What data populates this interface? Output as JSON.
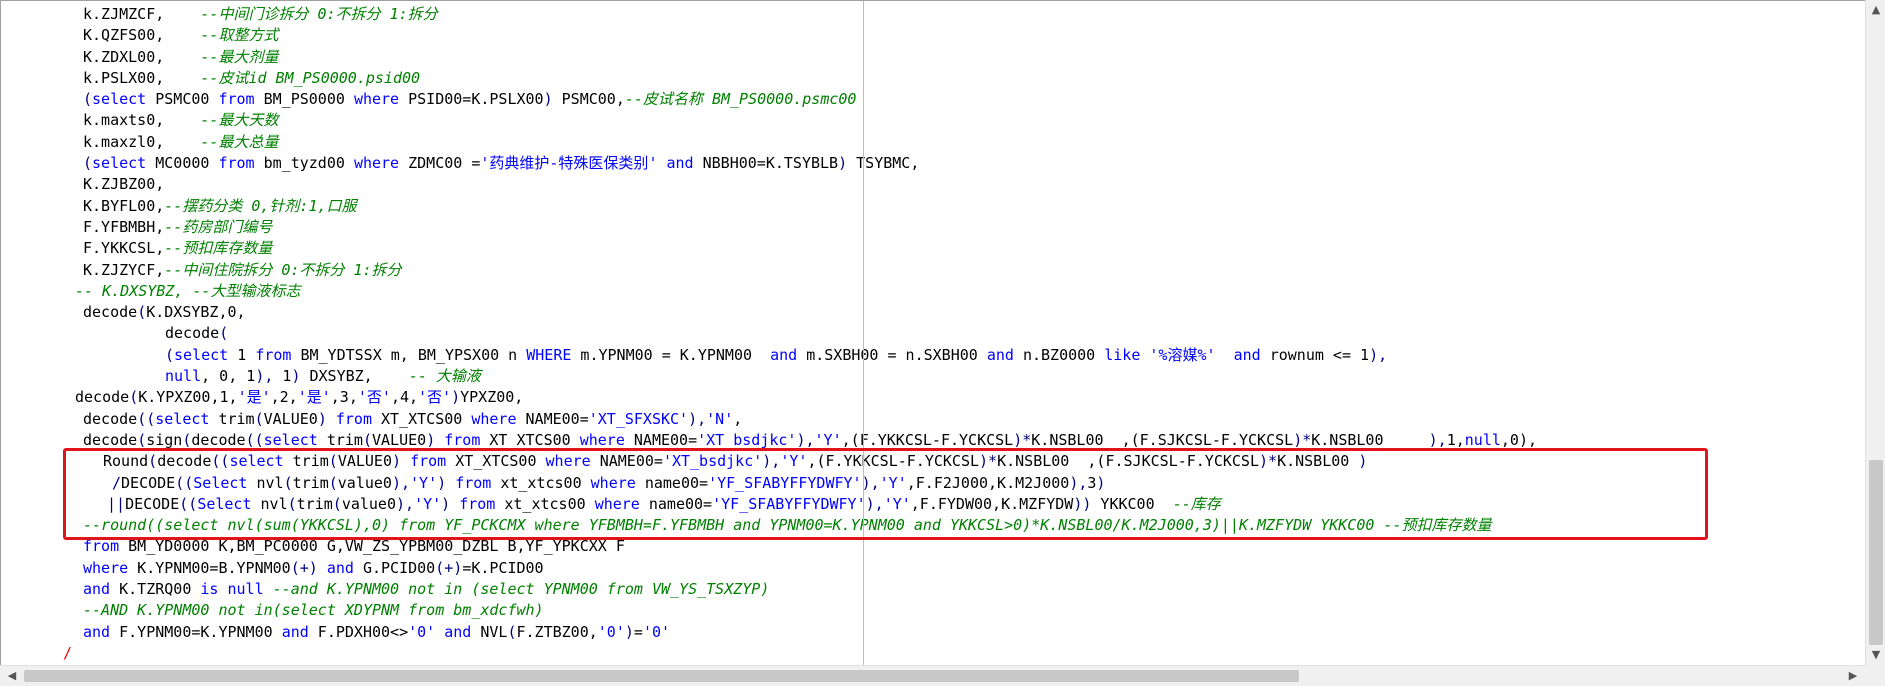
{
  "editor": {
    "lines": [
      {
        "indent": 82,
        "tokens": [
          {
            "t": "k.ZJMZCF,    "
          },
          {
            "t": "--中间门诊拆分 0:不拆分 1:拆分",
            "c": "cm"
          }
        ]
      },
      {
        "indent": 82,
        "tokens": [
          {
            "t": "K.QZFS00,    "
          },
          {
            "t": "--取整方式",
            "c": "cm"
          }
        ]
      },
      {
        "indent": 82,
        "tokens": [
          {
            "t": "K.ZDXL00,    "
          },
          {
            "t": "--最大剂量",
            "c": "cm"
          }
        ]
      },
      {
        "indent": 82,
        "tokens": [
          {
            "t": "k.PSLX00,    "
          },
          {
            "t": "--皮试id BM_PS0000.psid00",
            "c": "cm"
          }
        ]
      },
      {
        "indent": 82,
        "tokens": [
          {
            "t": "(",
            "c": "op"
          },
          {
            "t": "select",
            "c": "kw"
          },
          {
            "t": " PSMC00 "
          },
          {
            "t": "from",
            "c": "kw"
          },
          {
            "t": " BM_PS0000 "
          },
          {
            "t": "where",
            "c": "kw"
          },
          {
            "t": " PSID00="
          },
          {
            "t": "K.PSLX00"
          },
          {
            "t": ")",
            "c": "op"
          },
          {
            "t": " PSMC00,"
          },
          {
            "t": "--皮试名称 BM_PS0000.psmc00",
            "c": "cm"
          }
        ]
      },
      {
        "indent": 82,
        "tokens": [
          {
            "t": "k.maxts0,    "
          },
          {
            "t": "--最大天数",
            "c": "cm"
          }
        ]
      },
      {
        "indent": 82,
        "tokens": [
          {
            "t": "k.maxzl0,    "
          },
          {
            "t": "--最大总量",
            "c": "cm"
          }
        ]
      },
      {
        "indent": 82,
        "tokens": [
          {
            "t": "(",
            "c": "op"
          },
          {
            "t": "select",
            "c": "kw"
          },
          {
            "t": " MC0000 "
          },
          {
            "t": "from",
            "c": "kw"
          },
          {
            "t": " bm_tyzd00 "
          },
          {
            "t": "where",
            "c": "kw"
          },
          {
            "t": " ZDMC00 ="
          },
          {
            "t": "'药典维护-特殊医保类别'",
            "c": "st"
          },
          {
            "t": " "
          },
          {
            "t": "and",
            "c": "kw"
          },
          {
            "t": " NBBH00=K.TSYBLB"
          },
          {
            "t": ")",
            "c": "op"
          },
          {
            "t": " TSYBMC,"
          }
        ]
      },
      {
        "indent": 82,
        "tokens": [
          {
            "t": "K.ZJBZ00,"
          }
        ]
      },
      {
        "indent": 82,
        "tokens": [
          {
            "t": "K.BYFL00,"
          },
          {
            "t": "--摆药分类 0,针剂:1,口服",
            "c": "cm"
          }
        ]
      },
      {
        "indent": 82,
        "tokens": [
          {
            "t": "F.YFBMBH,"
          },
          {
            "t": "--药房部门编号",
            "c": "cm"
          }
        ]
      },
      {
        "indent": 82,
        "tokens": [
          {
            "t": "F.YKKCSL,"
          },
          {
            "t": "--预扣库存数量",
            "c": "cm"
          }
        ]
      },
      {
        "indent": 82,
        "tokens": [
          {
            "t": "K.ZJZYCF,"
          },
          {
            "t": "--中间住院拆分 0:不拆分 1:拆分",
            "c": "cm"
          }
        ]
      },
      {
        "indent": 74,
        "tokens": [
          {
            "t": "-- K.DXSYBZ, --大型输液标志",
            "c": "cm"
          }
        ]
      },
      {
        "indent": 82,
        "tokens": [
          {
            "t": "decode"
          },
          {
            "t": "(",
            "c": "op"
          },
          {
            "t": "K.DXSYBZ,0,"
          }
        ]
      },
      {
        "indent": 164,
        "tokens": [
          {
            "t": "decode"
          },
          {
            "t": "(",
            "c": "op"
          }
        ]
      },
      {
        "indent": 164,
        "tokens": [
          {
            "t": "(",
            "c": "op"
          },
          {
            "t": "select",
            "c": "kw"
          },
          {
            "t": " 1 "
          },
          {
            "t": "from",
            "c": "kw"
          },
          {
            "t": " BM_YDTSSX m, BM_YPSX00 n "
          },
          {
            "t": "WHERE",
            "c": "kw"
          },
          {
            "t": " m.YPNM00 = K.YPNM00  "
          },
          {
            "t": "and",
            "c": "kw"
          },
          {
            "t": " m.SXBH00 = n.SXBH00 "
          },
          {
            "t": "and",
            "c": "kw"
          },
          {
            "t": " n.BZ0000 "
          },
          {
            "t": "like",
            "c": "kw"
          },
          {
            "t": " "
          },
          {
            "t": "'%溶媒%'",
            "c": "st"
          },
          {
            "t": "  "
          },
          {
            "t": "and",
            "c": "kw"
          },
          {
            "t": " rownum <= 1"
          },
          {
            "t": "),",
            "c": "op"
          }
        ]
      },
      {
        "indent": 164,
        "tokens": [
          {
            "t": "null",
            "c": "kw"
          },
          {
            "t": ", 0, 1"
          },
          {
            "t": "),",
            "c": "op"
          },
          {
            "t": " 1"
          },
          {
            "t": ")",
            "c": "op"
          },
          {
            "t": " DXSYBZ,    "
          },
          {
            "t": "-- 大输液",
            "c": "cm"
          }
        ]
      },
      {
        "indent": 74,
        "tokens": [
          {
            "t": "decode"
          },
          {
            "t": "(",
            "c": "op"
          },
          {
            "t": "K.YPXZ00,1,"
          },
          {
            "t": "'是'",
            "c": "st"
          },
          {
            "t": ",2,"
          },
          {
            "t": "'是'",
            "c": "st"
          },
          {
            "t": ",3,"
          },
          {
            "t": "'否'",
            "c": "st"
          },
          {
            "t": ",4,"
          },
          {
            "t": "'否'",
            "c": "st"
          },
          {
            "t": ")",
            "c": "op"
          },
          {
            "t": "YPXZ00,"
          }
        ]
      },
      {
        "indent": 82,
        "tokens": [
          {
            "t": "decode"
          },
          {
            "t": "((",
            "c": "op"
          },
          {
            "t": "select",
            "c": "kw"
          },
          {
            "t": " trim"
          },
          {
            "t": "(",
            "c": "op"
          },
          {
            "t": "VALUE0"
          },
          {
            "t": ")",
            "c": "op"
          },
          {
            "t": " "
          },
          {
            "t": "from",
            "c": "kw"
          },
          {
            "t": " XT_XTCS00 "
          },
          {
            "t": "where",
            "c": "kw"
          },
          {
            "t": " NAME00="
          },
          {
            "t": "'XT_SFXSKC'",
            "c": "st"
          },
          {
            "t": "),",
            "c": "op"
          },
          {
            "t": "'N'",
            "c": "st"
          },
          {
            "t": ","
          }
        ]
      },
      {
        "indent": 82,
        "tokens": [
          {
            "t": "decode"
          },
          {
            "t": "(",
            "c": "op"
          },
          {
            "t": "sign"
          },
          {
            "t": "(",
            "c": "op"
          },
          {
            "t": "decode"
          },
          {
            "t": "((",
            "c": "op"
          },
          {
            "t": "select",
            "c": "kw"
          },
          {
            "t": " trim"
          },
          {
            "t": "(",
            "c": "op"
          },
          {
            "t": "VALUE0"
          },
          {
            "t": ")",
            "c": "op"
          },
          {
            "t": " "
          },
          {
            "t": "from",
            "c": "kw"
          },
          {
            "t": " XT_XTCS00 "
          },
          {
            "t": "where",
            "c": "kw"
          },
          {
            "t": " NAME00="
          },
          {
            "t": "'XT_bsdjkc'",
            "c": "st"
          },
          {
            "t": "),",
            "c": "op"
          },
          {
            "t": "'Y'",
            "c": "st"
          },
          {
            "t": ",("
          },
          {
            "t": "F.YKKCSL-F.YCKCSL"
          },
          {
            "t": ")*",
            "c": "op"
          },
          {
            "t": "K.NSBL00  ,("
          },
          {
            "t": "F.SJKCSL-F.YCKCSL"
          },
          {
            "t": ")*",
            "c": "op"
          },
          {
            "t": "K.NSBL00 "
          },
          {
            "t": "    ),",
            "c": "op"
          },
          {
            "t": "1,"
          },
          {
            "t": "null",
            "c": "kw"
          },
          {
            "t": ",0),"
          }
        ]
      },
      {
        "indent": 102,
        "tokens": [
          {
            "t": "Round"
          },
          {
            "t": "(",
            "c": "op"
          },
          {
            "t": "decode"
          },
          {
            "t": "((",
            "c": "op"
          },
          {
            "t": "select",
            "c": "kw"
          },
          {
            "t": " trim"
          },
          {
            "t": "(",
            "c": "op"
          },
          {
            "t": "VALUE0"
          },
          {
            "t": ")",
            "c": "op"
          },
          {
            "t": " "
          },
          {
            "t": "from",
            "c": "kw"
          },
          {
            "t": " XT_XTCS00 "
          },
          {
            "t": "where",
            "c": "kw"
          },
          {
            "t": " NAME00="
          },
          {
            "t": "'XT_bsdjkc'",
            "c": "st"
          },
          {
            "t": "),",
            "c": "op"
          },
          {
            "t": "'Y'",
            "c": "st"
          },
          {
            "t": ",("
          },
          {
            "t": "F.YKKCSL-F.YCKCSL"
          },
          {
            "t": ")*",
            "c": "op"
          },
          {
            "t": "K.NSBL00  ,("
          },
          {
            "t": "F.SJKCSL-F.YCKCSL"
          },
          {
            "t": ")*",
            "c": "op"
          },
          {
            "t": "K.NSBL00 "
          },
          {
            "t": ")",
            "c": "op"
          }
        ]
      },
      {
        "indent": 111,
        "tokens": [
          {
            "t": "/",
            "c": "op"
          },
          {
            "t": "DECODE"
          },
          {
            "t": "((",
            "c": "op"
          },
          {
            "t": "Select",
            "c": "kw"
          },
          {
            "t": " nvl"
          },
          {
            "t": "(",
            "c": "op"
          },
          {
            "t": "trim"
          },
          {
            "t": "(",
            "c": "op"
          },
          {
            "t": "value0"
          },
          {
            "t": "),",
            "c": "op"
          },
          {
            "t": "'Y'",
            "c": "st"
          },
          {
            "t": ")",
            "c": "op"
          },
          {
            "t": " "
          },
          {
            "t": "from",
            "c": "kw"
          },
          {
            "t": " xt_xtcs00 "
          },
          {
            "t": "where",
            "c": "kw"
          },
          {
            "t": " name00="
          },
          {
            "t": "'YF_SFABYFFYDWFY'",
            "c": "st"
          },
          {
            "t": "),",
            "c": "op"
          },
          {
            "t": "'Y'",
            "c": "st"
          },
          {
            "t": ",F.F2J000,K.M2J000"
          },
          {
            "t": "),",
            "c": "op"
          },
          {
            "t": "3"
          },
          {
            "t": ")",
            "c": "op"
          }
        ]
      },
      {
        "indent": 106,
        "tokens": [
          {
            "t": "||",
            "c": "op"
          },
          {
            "t": "DECODE"
          },
          {
            "t": "((",
            "c": "op"
          },
          {
            "t": "Select",
            "c": "kw"
          },
          {
            "t": " nvl"
          },
          {
            "t": "(",
            "c": "op"
          },
          {
            "t": "trim"
          },
          {
            "t": "(",
            "c": "op"
          },
          {
            "t": "value0"
          },
          {
            "t": "),",
            "c": "op"
          },
          {
            "t": "'Y'",
            "c": "st"
          },
          {
            "t": ")",
            "c": "op"
          },
          {
            "t": " "
          },
          {
            "t": "from",
            "c": "kw"
          },
          {
            "t": " xt_xtcs00 "
          },
          {
            "t": "where",
            "c": "kw"
          },
          {
            "t": " name00="
          },
          {
            "t": "'YF_SFABYFFYDWFY'",
            "c": "st"
          },
          {
            "t": "),",
            "c": "op"
          },
          {
            "t": "'Y'",
            "c": "st"
          },
          {
            "t": ",F.FYDW00,K.MZFYDW"
          },
          {
            "t": "))",
            "c": "op"
          },
          {
            "t": " YKKC00  "
          },
          {
            "t": "--库存",
            "c": "cm"
          }
        ]
      },
      {
        "indent": 82,
        "tokens": [
          {
            "t": "--round((select nvl(sum(YKKCSL),0) from YF_PCKCMX where YFBMBH=F.YFBMBH and YPNM00=K.YPNM00 and YKKCSL>0)*K.NSBL00/K.M2J000,3)||K.MZFYDW YKKC00 --预扣库存数量",
            "c": "cm"
          }
        ]
      },
      {
        "indent": 82,
        "tokens": [
          {
            "t": "from",
            "c": "kw"
          },
          {
            "t": " BM_YD0000 K,BM_PC0000 G,VW_ZS_YPBM00_DZBL B,YF_YPKCXX F"
          }
        ]
      },
      {
        "indent": 82,
        "tokens": [
          {
            "t": "where",
            "c": "kw"
          },
          {
            "t": " K.YPNM00=B.YPNM00"
          },
          {
            "t": "(+)",
            "c": "op"
          },
          {
            "t": " "
          },
          {
            "t": "and",
            "c": "kw"
          },
          {
            "t": " G.PCID00"
          },
          {
            "t": "(+)",
            "c": "op"
          },
          {
            "t": "=K.PCID00"
          }
        ]
      },
      {
        "indent": 82,
        "tokens": [
          {
            "t": "and",
            "c": "kw"
          },
          {
            "t": " K.TZRQ00 "
          },
          {
            "t": "is",
            "c": "kw"
          },
          {
            "t": " "
          },
          {
            "t": "null",
            "c": "kw"
          },
          {
            "t": " "
          },
          {
            "t": "--and K.YPNM00 not in (select YPNM00 from VW_YS_TSXZYP)",
            "c": "cm"
          }
        ]
      },
      {
        "indent": 82,
        "tokens": [
          {
            "t": "--AND K.YPNM00 not in(select XDYPNM from bm_xdcfwh)",
            "c": "cm"
          }
        ]
      },
      {
        "indent": 82,
        "tokens": [
          {
            "t": "and",
            "c": "kw"
          },
          {
            "t": " F.YPNM00=K.YPNM00 "
          },
          {
            "t": "and",
            "c": "kw"
          },
          {
            "t": " F.PDXH00<>"
          },
          {
            "t": "'0'",
            "c": "st"
          },
          {
            "t": " "
          },
          {
            "t": "and",
            "c": "kw"
          },
          {
            "t": " NVL"
          },
          {
            "t": "(",
            "c": "op"
          },
          {
            "t": "F.ZTBZ00,"
          },
          {
            "t": "'0'",
            "c": "st"
          },
          {
            "t": ")",
            "c": "op"
          },
          {
            "t": "="
          },
          {
            "t": "'0'",
            "c": "st"
          }
        ]
      },
      {
        "indent": 62,
        "tokens": [
          {
            "t": "/",
            "c": "gutter-mark"
          }
        ]
      }
    ]
  },
  "scrollbars": {
    "up_arrow": "▲",
    "down_arrow": "▼",
    "left_arrow": "◀",
    "right_arrow": "▶"
  }
}
